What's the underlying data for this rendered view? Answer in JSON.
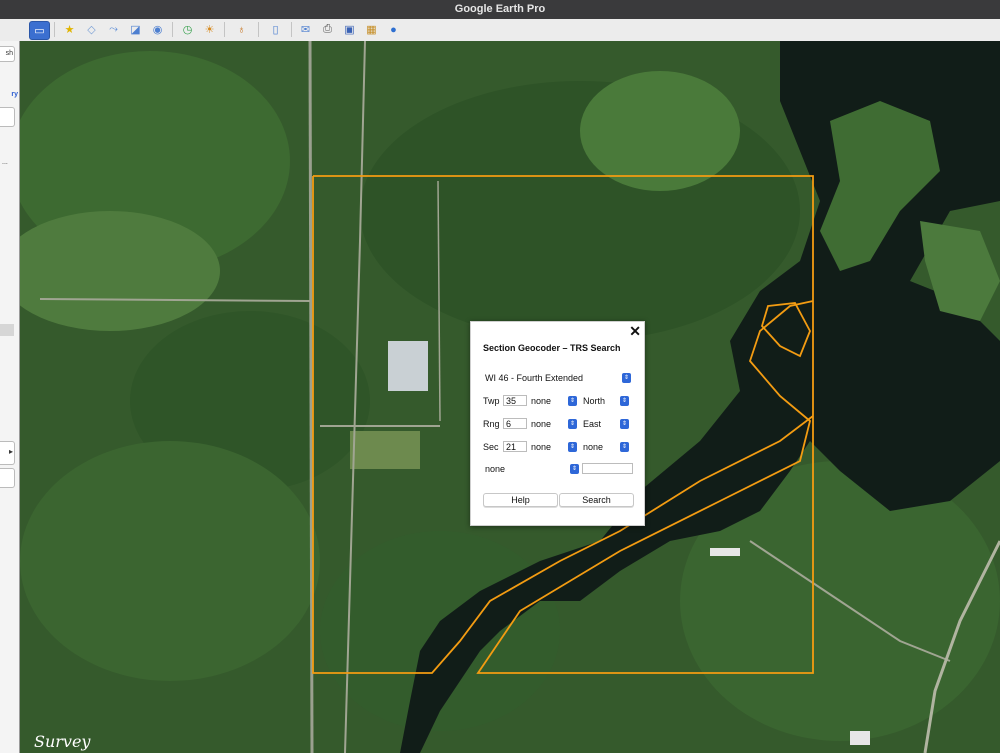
{
  "window": {
    "title": "Google Earth Pro"
  },
  "sidebar": {
    "snippets": [
      "sh",
      "ry",
      "..."
    ]
  },
  "dialog": {
    "title": "Section Geocoder – TRS Search",
    "meridian": "WI 46 - Fourth Extended",
    "twp": {
      "label": "Twp",
      "value": "35",
      "fraction": "none",
      "dir": "North"
    },
    "rng": {
      "label": "Rng",
      "value": "6",
      "fraction": "none",
      "dir": "East"
    },
    "sec": {
      "label": "Sec",
      "value": "21",
      "fraction1": "none",
      "fraction2": "none"
    },
    "extra": {
      "option": "none",
      "value": ""
    },
    "help_label": "Help",
    "search_label": "Search"
  },
  "map": {
    "overlay_text": "Survey",
    "boundary_color": "#f39c12"
  }
}
